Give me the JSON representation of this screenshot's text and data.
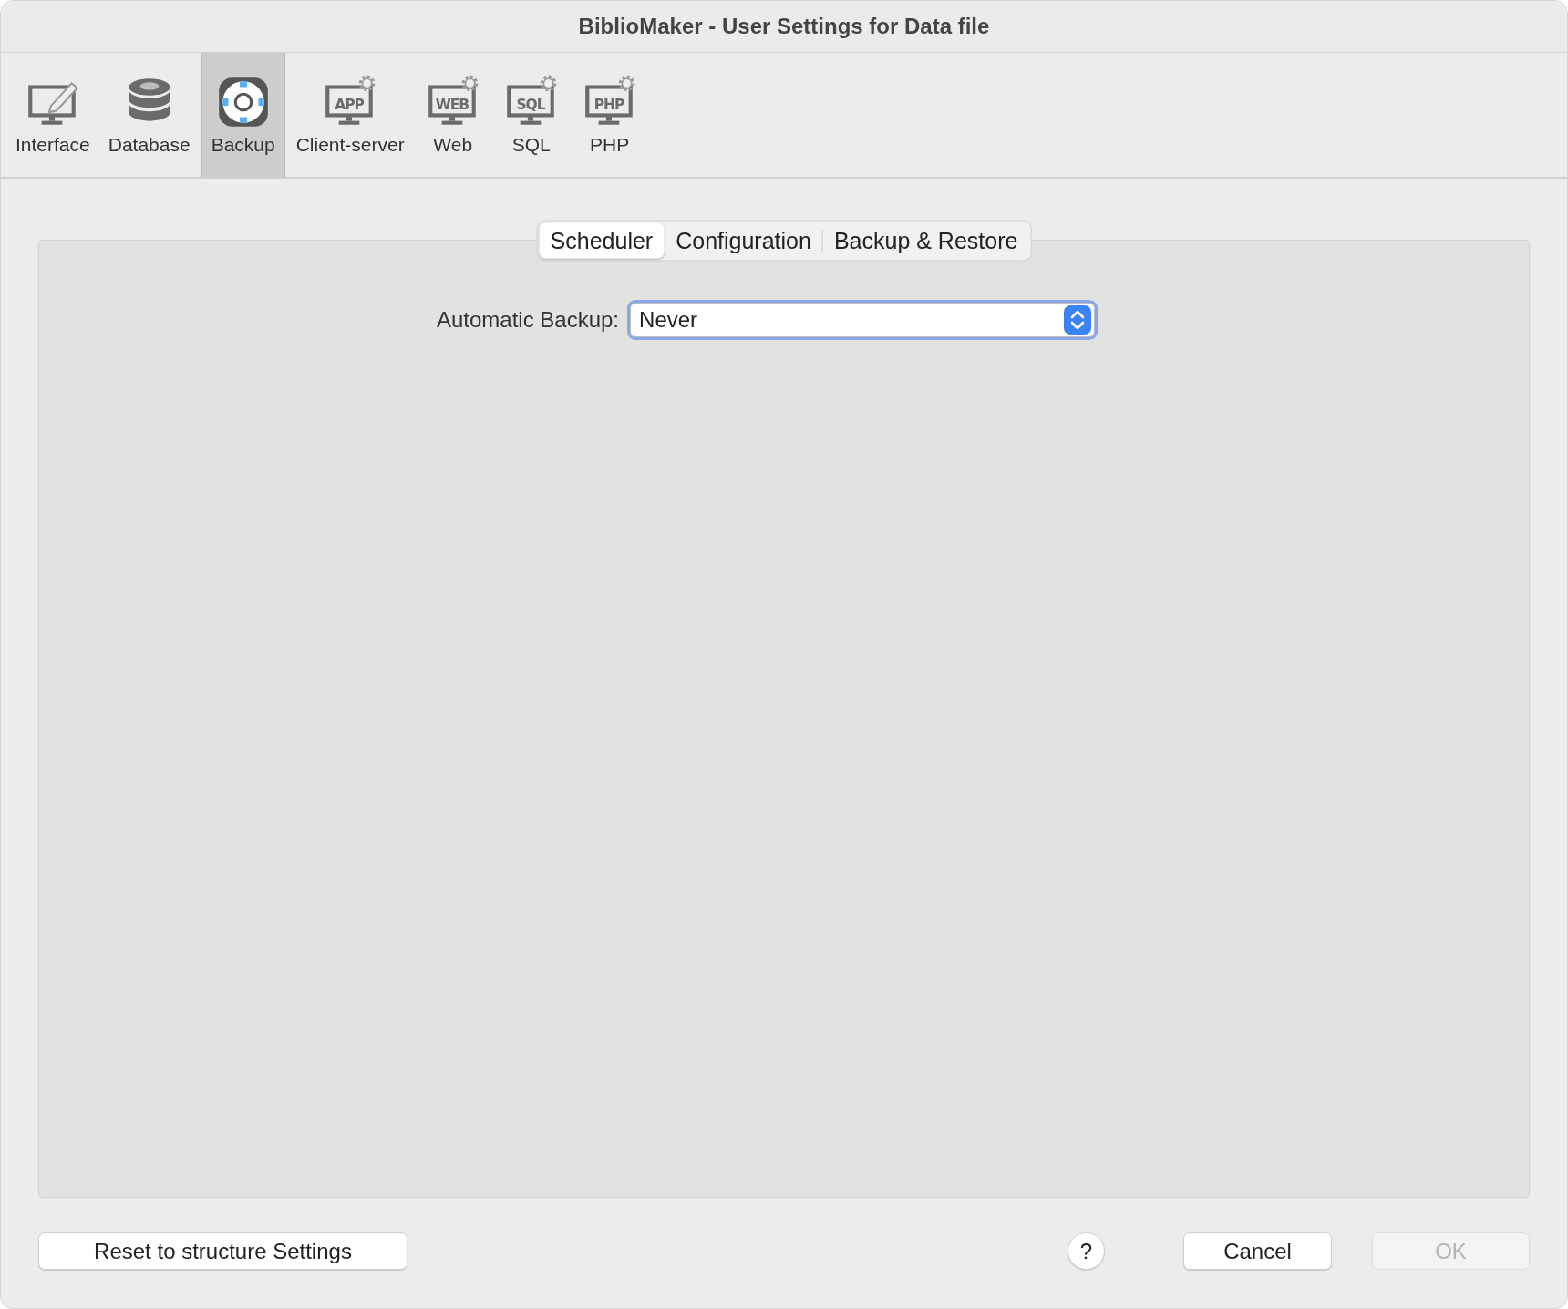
{
  "window": {
    "title": "BiblioMaker - User Settings for Data file"
  },
  "toolbar": [
    {
      "label": "Interface",
      "kind": "monitor-pencil",
      "selected": false
    },
    {
      "label": "Database",
      "kind": "database",
      "selected": false
    },
    {
      "label": "Backup",
      "kind": "lifebuoy",
      "selected": true
    },
    {
      "label": "Client-server",
      "kind": "monitor-gear",
      "icon_text": "APP",
      "selected": false
    },
    {
      "label": "Web",
      "kind": "monitor-gear",
      "icon_text": "WEB",
      "selected": false
    },
    {
      "label": "SQL",
      "kind": "monitor-gear",
      "icon_text": "SQL",
      "selected": false
    },
    {
      "label": "PHP",
      "kind": "monitor-gear",
      "icon_text": "PHP",
      "selected": false
    }
  ],
  "tabs": [
    {
      "label": "Scheduler",
      "selected": true
    },
    {
      "label": "Configuration",
      "selected": false
    },
    {
      "label": "Backup & Restore",
      "selected": false
    }
  ],
  "automatic_backup": {
    "label": "Automatic Backup:",
    "value": "Never"
  },
  "buttons": [
    {
      "label": "Reset to structure Settings",
      "kind": "reset",
      "disabled": false
    },
    {
      "label": "?",
      "kind": "help",
      "disabled": false
    },
    {
      "label": "Cancel",
      "kind": "cancel",
      "disabled": false
    },
    {
      "label": "OK",
      "kind": "ok",
      "disabled": true
    }
  ]
}
